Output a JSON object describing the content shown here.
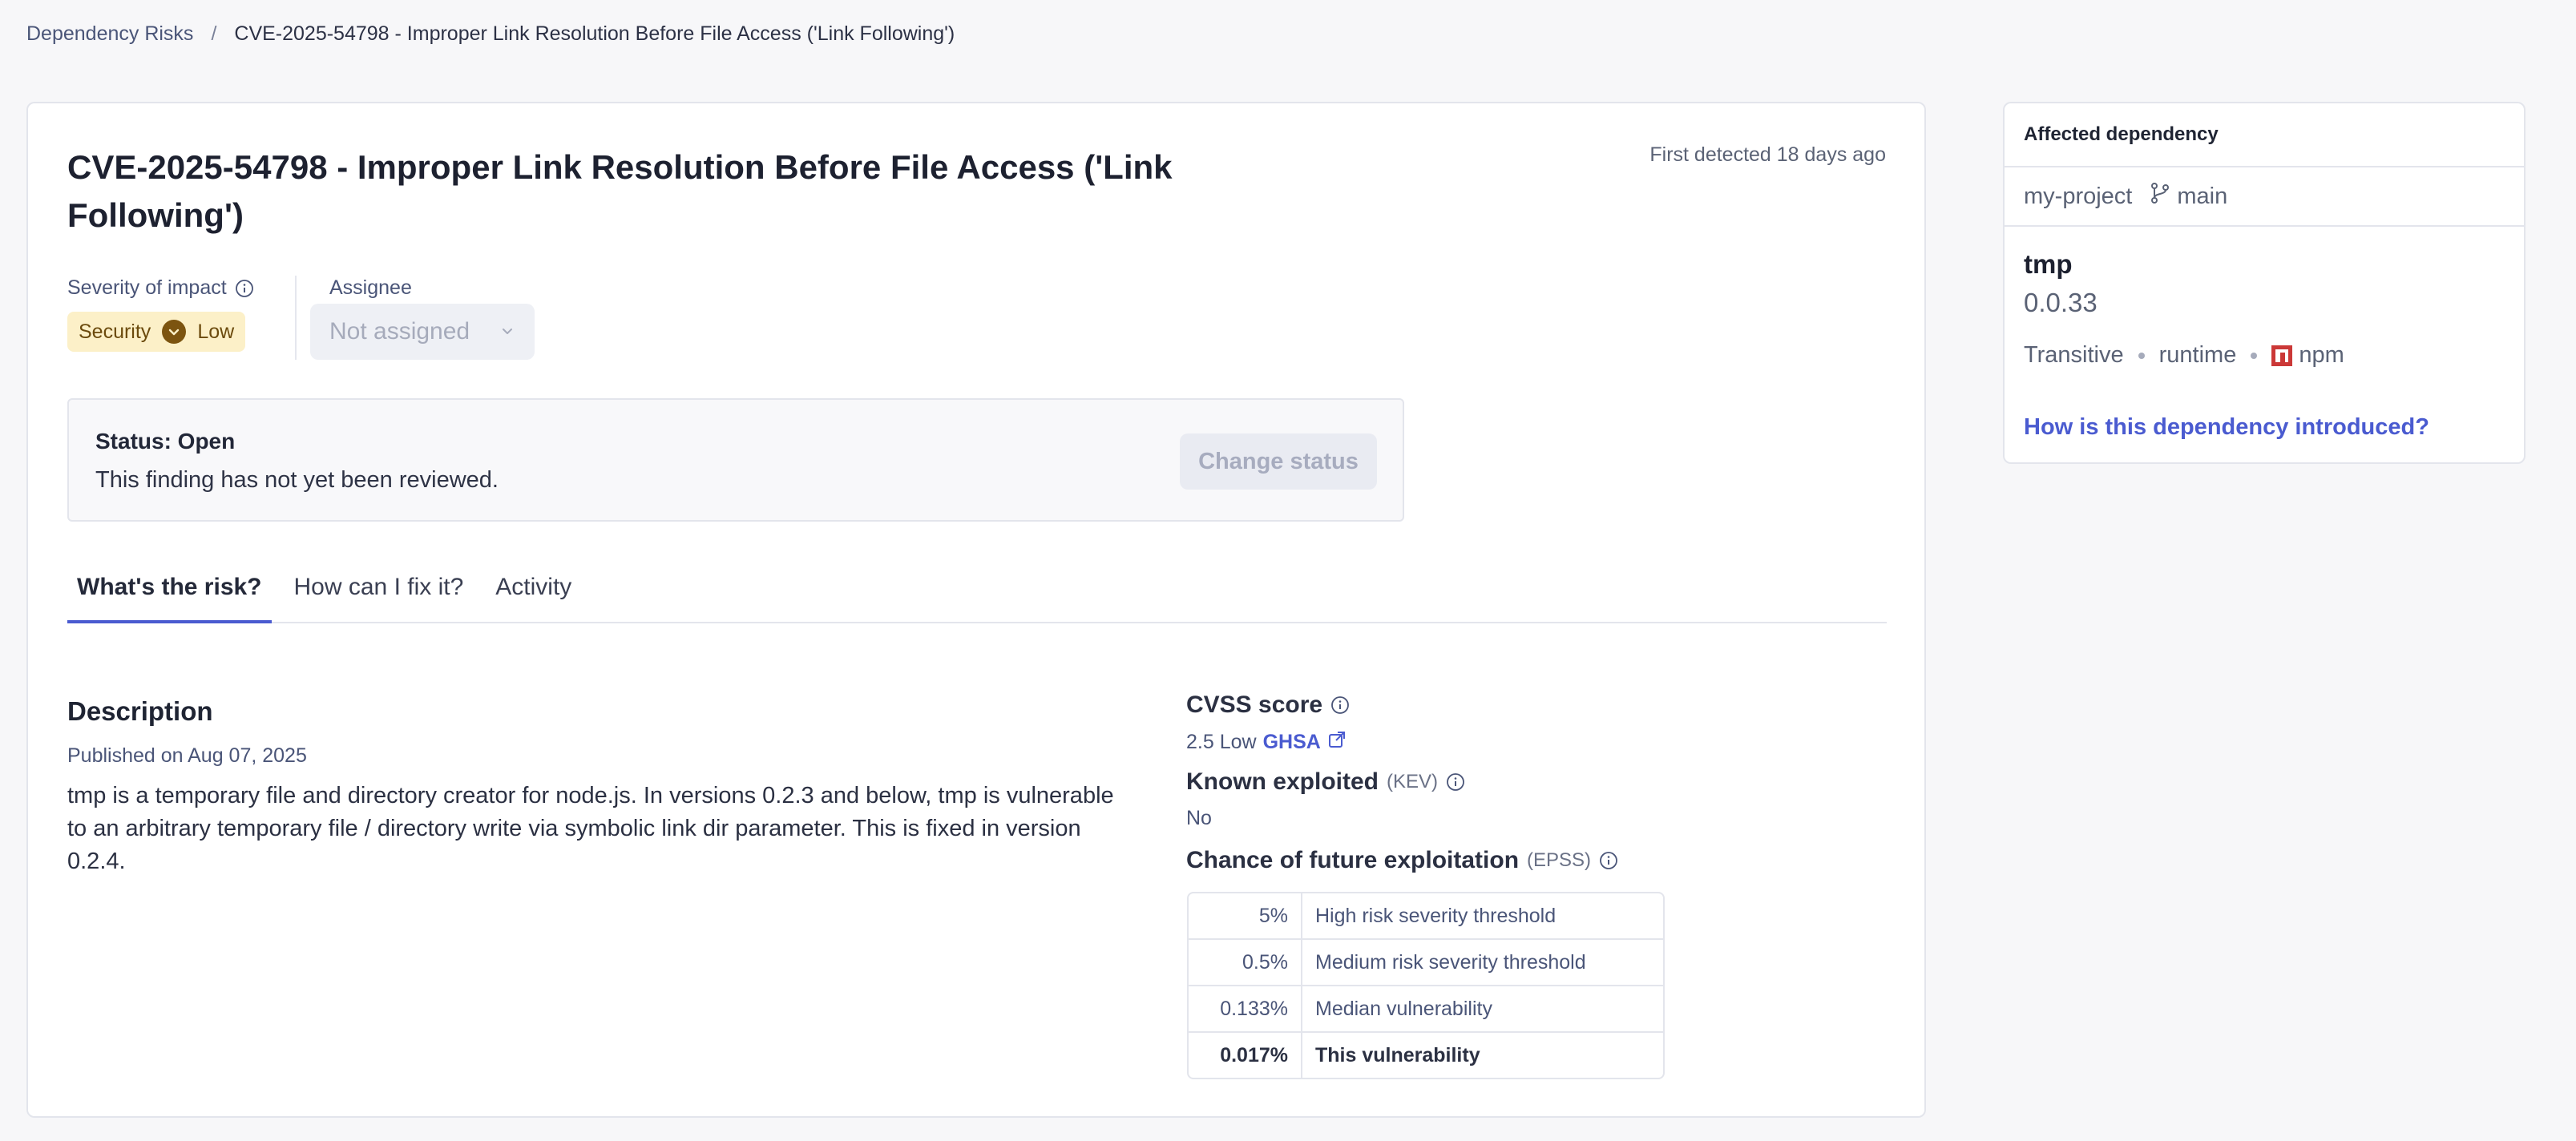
{
  "breadcrumb": {
    "parent": "Dependency Risks",
    "separator": "/",
    "current": "CVE-2025-54798 - Improper Link Resolution Before File Access ('Link Following')"
  },
  "header": {
    "title": "CVE-2025-54798 - Improper Link Resolution Before File Access ('Link Following')",
    "first_detected": "First detected 18 days ago"
  },
  "severity": {
    "label": "Severity of impact",
    "category": "Security",
    "level": "Low",
    "icon": "chevron-down-circle-icon",
    "badge_bg": "#fcf0c8",
    "dot_color": "#7c5410"
  },
  "assignee": {
    "label": "Assignee",
    "value": "Not assigned"
  },
  "status": {
    "title": "Status: Open",
    "description": "This finding has not yet been reviewed.",
    "button": "Change status"
  },
  "tabs": [
    {
      "label": "What's the risk?",
      "active": true
    },
    {
      "label": "How can I fix it?",
      "active": false
    },
    {
      "label": "Activity",
      "active": false
    }
  ],
  "description": {
    "heading": "Description",
    "published": "Published on Aug 07, 2025",
    "body": "tmp is a temporary file and directory creator for node.js. In versions 0.2.3 and below, tmp is vulnerable to an arbitrary temporary file / directory write via symbolic link dir parameter. This is fixed in version 0.2.4."
  },
  "cvss": {
    "heading": "CVSS score",
    "value": "2.5 Low",
    "source": "GHSA"
  },
  "kev": {
    "heading": "Known exploited",
    "sub": "(KEV)",
    "value": "No"
  },
  "epss": {
    "heading": "Chance of future exploitation",
    "sub": "(EPSS)",
    "rows": [
      {
        "pct": "5%",
        "label": "High risk severity threshold"
      },
      {
        "pct": "0.5%",
        "label": "Medium risk severity threshold"
      },
      {
        "pct": "0.133%",
        "label": "Median vulnerability"
      },
      {
        "pct": "0.017%",
        "label": "This vulnerability"
      }
    ]
  },
  "affected": {
    "heading": "Affected dependency",
    "project": "my-project",
    "branch": "main",
    "package": "tmp",
    "version": "0.0.33",
    "type": "Transitive",
    "scope": "runtime",
    "ecosystem": "npm",
    "link": "How is this dependency introduced?"
  },
  "colors": {
    "accent": "#4a5bd0",
    "npm": "#cb3837"
  }
}
